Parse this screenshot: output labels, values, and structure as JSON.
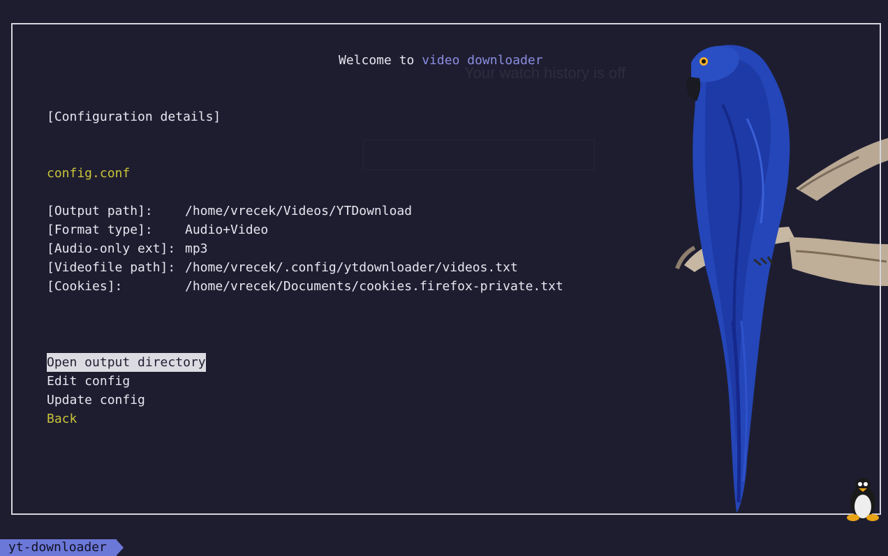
{
  "welcome": {
    "prefix": "Welcome to ",
    "app_name": "video downloader"
  },
  "section_title": "[Configuration details]",
  "config_file": "config.conf",
  "config_rows": [
    {
      "label": "[Output path]:",
      "value": "/home/vrecek/Videos/YTDownload"
    },
    {
      "label": "[Format type]:",
      "value": "Audio+Video"
    },
    {
      "label": "[Audio-only ext]:",
      "value": "mp3"
    },
    {
      "label": "[Videofile path]:",
      "value": "/home/vrecek/.config/ytdownloader/videos.txt"
    },
    {
      "label": "[Cookies]:",
      "value": "/home/vrecek/Documents/cookies.firefox-private.txt"
    }
  ],
  "menu": {
    "open_output": "Open output directory",
    "edit_config": "Edit config",
    "update_config": "Update config",
    "back": "Back"
  },
  "statusbar": {
    "tab_name": "yt-downloader"
  },
  "colors": {
    "background": "#1e1d30",
    "accent_blue": "#8b8ee0",
    "accent_yellow": "#c9c43a",
    "status_tag": "#6b78d8",
    "selection_bg": "#dcdbe2"
  },
  "icons": {
    "wallpaper": "parrot-image",
    "corner": "tux-penguin-icon"
  }
}
